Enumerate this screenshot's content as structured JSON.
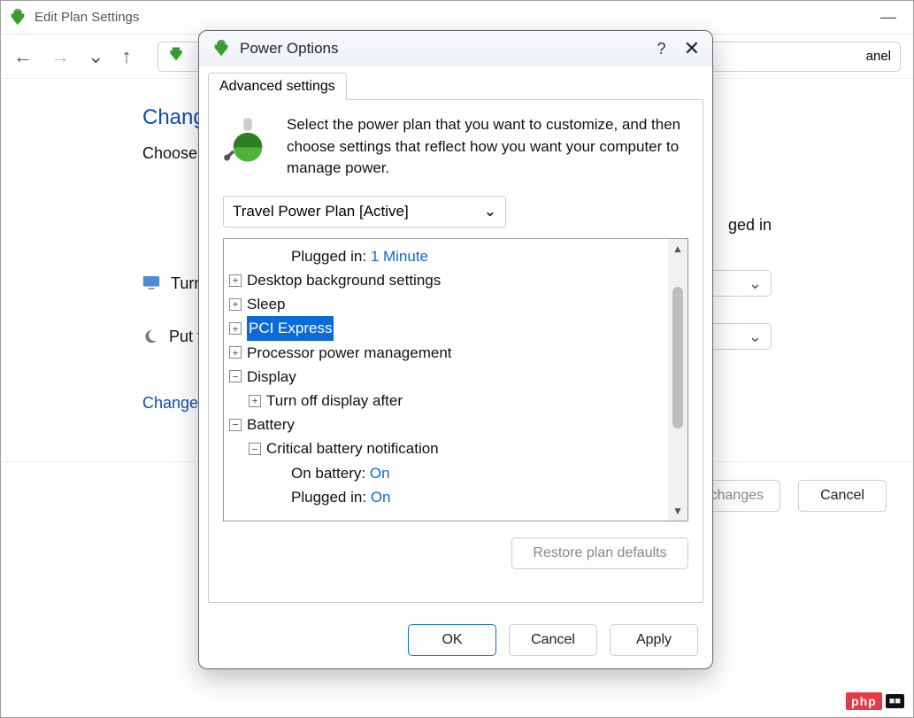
{
  "parent": {
    "title": "Edit Plan Settings",
    "breadcrumb_tail": "anel",
    "heading_prefix": "Change",
    "choose_prefix": "Choose t",
    "plugged_tail": "ged in",
    "row_turn": "Turn",
    "row_put": "Put t",
    "link_change": "Change a",
    "save_partial": "e changes",
    "cancel": "Cancel"
  },
  "dialog": {
    "title": "Power Options",
    "tab": "Advanced settings",
    "description": "Select the power plan that you want to customize, and then choose settings that reflect how you want your computer to manage power.",
    "plan": "Travel Power Plan [Active]",
    "restore": "Restore plan defaults",
    "ok": "OK",
    "cancel": "Cancel",
    "apply": "Apply",
    "tree": {
      "plugged_label": "Plugged in:",
      "plugged_value": "1 Minute",
      "desktop_bg": "Desktop background settings",
      "sleep": "Sleep",
      "pci": "PCI Express",
      "proc": "Processor power management",
      "display": "Display",
      "turn_off_display": "Turn off display after",
      "battery": "Battery",
      "crit_notif": "Critical battery notification",
      "on_batt_label": "On battery:",
      "on_batt_value": "On",
      "plugged2_label": "Plugged in:",
      "plugged2_value": "On"
    }
  },
  "badge": {
    "php": "php",
    "cn": "■■"
  }
}
